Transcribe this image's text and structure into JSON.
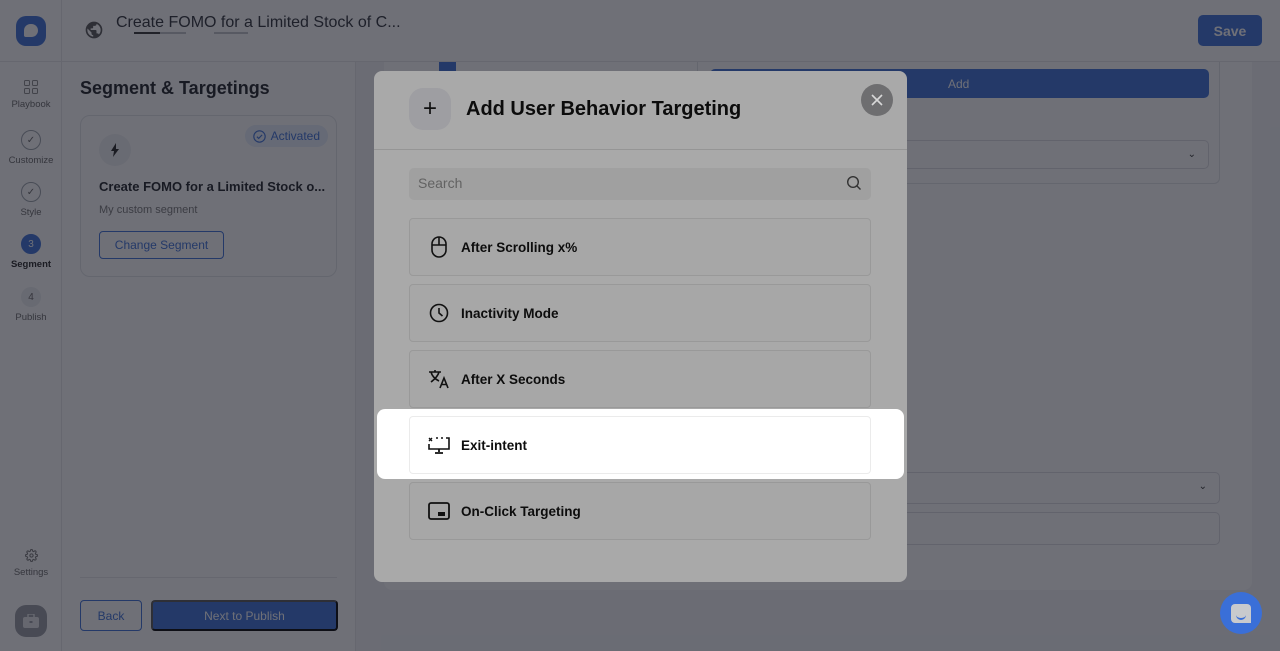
{
  "header": {
    "title": "Create FOMO for a Limited Stock of C...",
    "save_label": "Save"
  },
  "nav": {
    "items": [
      {
        "label": "Playbook",
        "icon": "grid-icon",
        "state": "default"
      },
      {
        "label": "Customize",
        "icon": "check-circle-icon",
        "state": "done"
      },
      {
        "label": "Style",
        "icon": "check-circle-icon",
        "state": "done"
      },
      {
        "label": "Segment",
        "step": "3",
        "state": "active"
      },
      {
        "label": "Publish",
        "step": "4",
        "state": "pending"
      }
    ],
    "settings_label": "Settings"
  },
  "segment_panel": {
    "heading": "Segment & Targetings",
    "card": {
      "badge": "Activated",
      "name": "Create FOMO for a Limited Stock o...",
      "description": "My custom segment",
      "change_label": "Change Segment"
    },
    "back_label": "Back",
    "next_label": "Next to Publish"
  },
  "workspace": {
    "add_label": "Add"
  },
  "modal": {
    "title": "Add User Behavior Targeting",
    "search_placeholder": "Search",
    "options": [
      {
        "label": "After Scrolling x%",
        "icon": "mouse-icon"
      },
      {
        "label": "Inactivity Mode",
        "icon": "clock-icon"
      },
      {
        "label": "After X Seconds",
        "icon": "translate-icon"
      },
      {
        "label": "Exit-intent",
        "icon": "exit-monitor-icon",
        "highlighted": true
      },
      {
        "label": "On-Click Targeting",
        "icon": "picture-in-picture-icon"
      }
    ]
  },
  "colors": {
    "accent": "#3a6fd8",
    "overlay": "#161824"
  }
}
